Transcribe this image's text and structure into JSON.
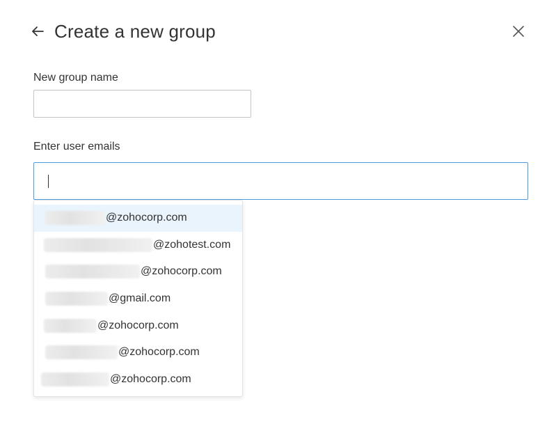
{
  "header": {
    "title": "Create a new group"
  },
  "form": {
    "group_name_label": "New group name",
    "group_name_value": "",
    "emails_label": "Enter user emails",
    "emails_value": ""
  },
  "suggestions": [
    {
      "domain": "@zohocorp.com",
      "active": true
    },
    {
      "domain": "@zohotest.com",
      "active": false
    },
    {
      "domain": "@zohocorp.com",
      "active": false
    },
    {
      "domain": "@gmail.com",
      "active": false
    },
    {
      "domain": "@zohocorp.com",
      "active": false
    },
    {
      "domain": "@zohocorp.com",
      "active": false
    },
    {
      "domain": "@zohocorp.com",
      "active": false
    }
  ],
  "icons": {
    "back": "arrow-left-icon",
    "close": "close-icon"
  },
  "colors": {
    "focus_border": "#4a9be0",
    "active_row": "#eaf4fc",
    "text": "#333333"
  }
}
